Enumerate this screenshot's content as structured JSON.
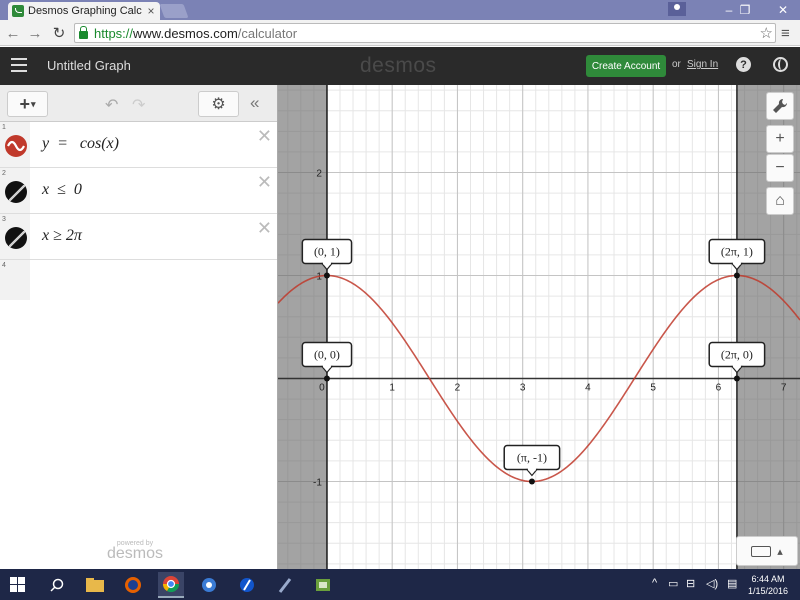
{
  "browser": {
    "tab_title": "Desmos Graphing Calculat",
    "tab_close": "×",
    "url_scheme": "https://",
    "url_domain": "www.desmos.com",
    "url_path": "/calculator",
    "back_glyph": "←",
    "forward_glyph": "→",
    "reload_glyph": "↻",
    "star_glyph": "☆",
    "menu_glyph": "≡",
    "minimize_glyph": "–",
    "maximize_glyph": "❐",
    "close_glyph": "✕"
  },
  "header": {
    "graph_title": "Untitled Graph",
    "logo": "desmos",
    "create_account": "Create Account",
    "or": "or",
    "sign_in": "Sign In",
    "help": "?"
  },
  "toolbar": {
    "add": "+",
    "add_caret": "▾",
    "undo": "↶",
    "redo": "↷",
    "settings": "⚙",
    "collapse": "«"
  },
  "expressions": [
    {
      "index": "1",
      "latex": "y  =   cos(x)",
      "icon": "wave-icon",
      "color": "#c0392b"
    },
    {
      "index": "2",
      "latex": "x  ≤  0",
      "icon": "shade-icon",
      "color": "#111111"
    },
    {
      "index": "3",
      "latex": "x ≥ 2π",
      "icon": "shade-icon",
      "color": "#111111"
    },
    {
      "index": "4",
      "latex": "",
      "icon": "",
      "color": ""
    }
  ],
  "delete_glyph": "✕",
  "powered_by": "powered by",
  "powered_logo": "desmos",
  "graph_tools": {
    "wrench": "🔧",
    "zoom_in": "+",
    "zoom_out": "−",
    "home": "⌂",
    "keyboard_caret": "▴"
  },
  "chart_data": {
    "type": "line",
    "xlim": [
      -0.75,
      7.25
    ],
    "ylim": [
      -1.85,
      2.85
    ],
    "x_ticks": [
      "0",
      "1",
      "2",
      "3",
      "4",
      "5",
      "6",
      "7"
    ],
    "y_ticks": [
      "2",
      "1",
      "-1"
    ],
    "grid": true,
    "series": [
      {
        "function": "cos(x)",
        "color": "#c0392b"
      }
    ],
    "shaded_regions": [
      {
        "condition": "x ≤ 0",
        "color": "#666666"
      },
      {
        "condition": "x ≥ 2π",
        "color": "#666666"
      }
    ],
    "points": [
      {
        "label": "(0, 1)",
        "x": 0,
        "y": 1
      },
      {
        "label": "(0, 0)",
        "x": 0,
        "y": 0
      },
      {
        "label": "(π, -1)",
        "x": 3.14159,
        "y": -1
      },
      {
        "label": "(2π, 1)",
        "x": 6.28318,
        "y": 1
      },
      {
        "label": "(2π, 0)",
        "x": 6.28318,
        "y": 0
      }
    ]
  },
  "taskbar": {
    "time": "6:44 AM",
    "date": "1/15/2016"
  }
}
